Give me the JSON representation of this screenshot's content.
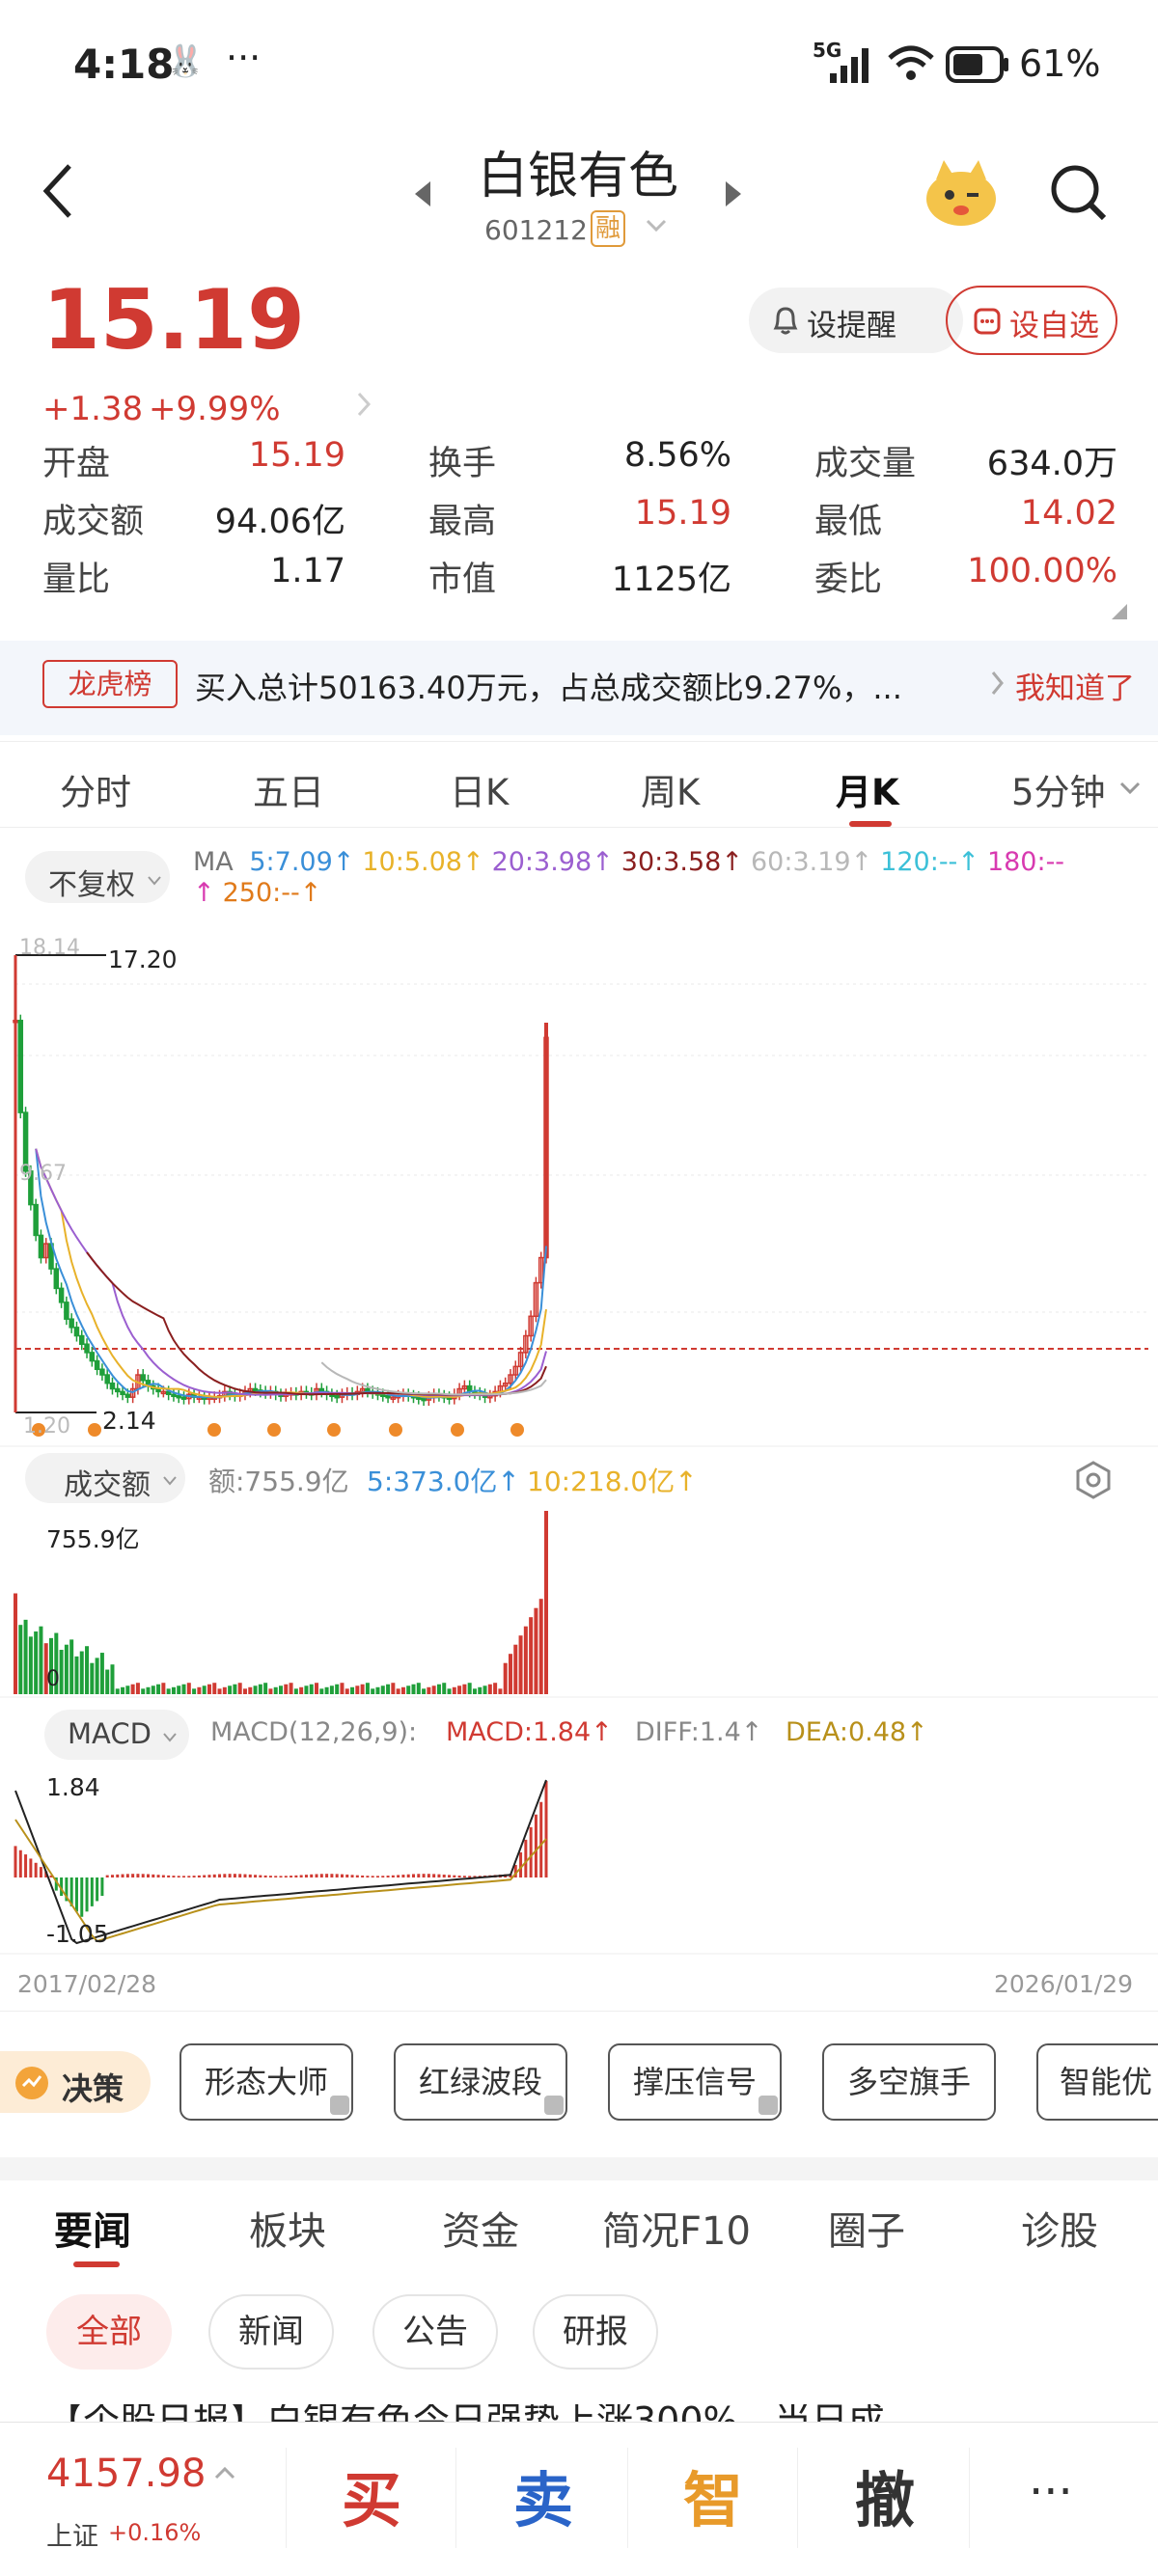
{
  "status_bar": {
    "time": "4:18",
    "dots": "···",
    "network": "5G",
    "battery": "61%"
  },
  "header": {
    "title": "白银有色",
    "code": "601212",
    "margin_badge": "融"
  },
  "quote": {
    "price": "15.19",
    "change": "+1.38",
    "change_pct": "+9.99%",
    "alert_label": "设提醒",
    "watch_label": "设自选",
    "rows": [
      [
        {
          "label": "开盘",
          "value": "15.19",
          "color": "red"
        },
        {
          "label": "换手",
          "value": "8.56%",
          "color": "dark"
        },
        {
          "label": "成交量",
          "value": "634.0万",
          "color": "dark"
        }
      ],
      [
        {
          "label": "成交额",
          "value": "94.06亿",
          "color": "dark"
        },
        {
          "label": "最高",
          "value": "15.19",
          "color": "red"
        },
        {
          "label": "最低",
          "value": "14.02",
          "color": "red"
        }
      ],
      [
        {
          "label": "量比",
          "value": "1.17",
          "color": "dark"
        },
        {
          "label": "市值",
          "value": "1125亿",
          "color": "dark"
        },
        {
          "label": "委比",
          "value": "100.00%",
          "color": "red"
        }
      ]
    ]
  },
  "banner": {
    "tag": "龙虎榜",
    "text": "买入总计50163.40万元，占总成交额比9.27%，...",
    "action": "我知道了"
  },
  "chart_tabs": {
    "items": [
      "分时",
      "五日",
      "日K",
      "周K",
      "月K",
      "5分钟"
    ],
    "active": "月K"
  },
  "ma_bar": {
    "adjust": "不复权",
    "prefix": "MA",
    "items": [
      {
        "text": "5:7.09↑",
        "color": "#3a8fd8"
      },
      {
        "text": "10:5.08↑",
        "color": "#e8b22a"
      },
      {
        "text": "20:3.98↑",
        "color": "#9b5fd0"
      },
      {
        "text": "30:3.58↑",
        "color": "#8a1f1f"
      },
      {
        "text": "60:3.19↑",
        "color": "#b8b8b8"
      },
      {
        "text": "120:--↑",
        "color": "#3cc0d8"
      },
      {
        "text": "180:--↑",
        "color": "#d83ab0"
      },
      {
        "text": "250:--↑",
        "color": "#e07a1a"
      }
    ]
  },
  "kchart": {
    "high_label": "17.20",
    "low_label": "2.14",
    "axis_top": "18.14",
    "axis_mid": "9.67",
    "axis_bottom": "1.20"
  },
  "volume": {
    "selector": "成交额",
    "total": "额:755.9亿",
    "ma5": "5:373.0亿↑",
    "ma10": "10:218.0亿↑",
    "max_label": "755.9亿",
    "zero_label": "0"
  },
  "macd": {
    "selector": "MACD",
    "params": "MACD(12,26,9):",
    "macd": "MACD:1.84↑",
    "diff": "DIFF:1.4↑",
    "dea": "DEA:0.48↑",
    "max_label": "1.84",
    "min_label": "-1.05"
  },
  "date_range": {
    "start": "2017/02/28",
    "end": "2026/01/29"
  },
  "tools": {
    "decision": "决策",
    "items": [
      "形态大师",
      "红绿波段",
      "撑压信号",
      "多空旗手",
      "智能优"
    ]
  },
  "news": {
    "tabs": [
      "要闻",
      "板块",
      "资金",
      "简况F10",
      "圈子",
      "诊股"
    ],
    "active": "要闻",
    "filters": [
      "全部",
      "新闻",
      "公告",
      "研报"
    ],
    "headline": "【个股日报】白银有色今日强势上涨300%，当日成"
  },
  "bottom_bar": {
    "index_value": "4157.98",
    "index_name": "上证",
    "index_change": "+0.16%",
    "buy": "买",
    "sell": "卖",
    "smart": "智",
    "cancel": "撤",
    "more": "···"
  },
  "chart_data": {
    "type": "candlestick",
    "title": "",
    "x_start": "2017/02/28",
    "x_end": "2026/01/29",
    "ylim": [
      1.2,
      18.14
    ],
    "closes": [
      15.8,
      12.5,
      10.4,
      9.2,
      8.1,
      7.3,
      7.8,
      6.9,
      6.2,
      5.7,
      5.1,
      4.8,
      4.5,
      4.2,
      3.9,
      3.6,
      3.3,
      3.1,
      2.8,
      2.6,
      2.5,
      2.4,
      2.3,
      2.6,
      3.1,
      2.9,
      2.7,
      2.6,
      2.5,
      2.5,
      2.4,
      2.35,
      2.3,
      2.25,
      2.4,
      2.3,
      2.3,
      2.25,
      2.3,
      2.3,
      2.35,
      2.5,
      2.4,
      2.35,
      2.4,
      2.5,
      2.6,
      2.55,
      2.5,
      2.45,
      2.5,
      2.4,
      2.35,
      2.4,
      2.45,
      2.4,
      2.5,
      2.45,
      2.4,
      2.6,
      2.5,
      2.4,
      2.35,
      2.3,
      2.4,
      2.45,
      2.4,
      2.5,
      2.6,
      2.5,
      2.45,
      2.4,
      2.35,
      2.3,
      2.3,
      2.35,
      2.4,
      2.35,
      2.3,
      2.25,
      2.2,
      2.3,
      2.4,
      2.35,
      2.3,
      2.25,
      2.4,
      2.6,
      2.7,
      2.5,
      2.45,
      2.4,
      2.3,
      2.35,
      2.5,
      2.7,
      2.8,
      3.1,
      3.4,
      3.9,
      4.5,
      5.2,
      6.4,
      7.3,
      15.19
    ],
    "volume_max": "755.9亿",
    "macd_range": [
      -1.05,
      1.84
    ]
  }
}
